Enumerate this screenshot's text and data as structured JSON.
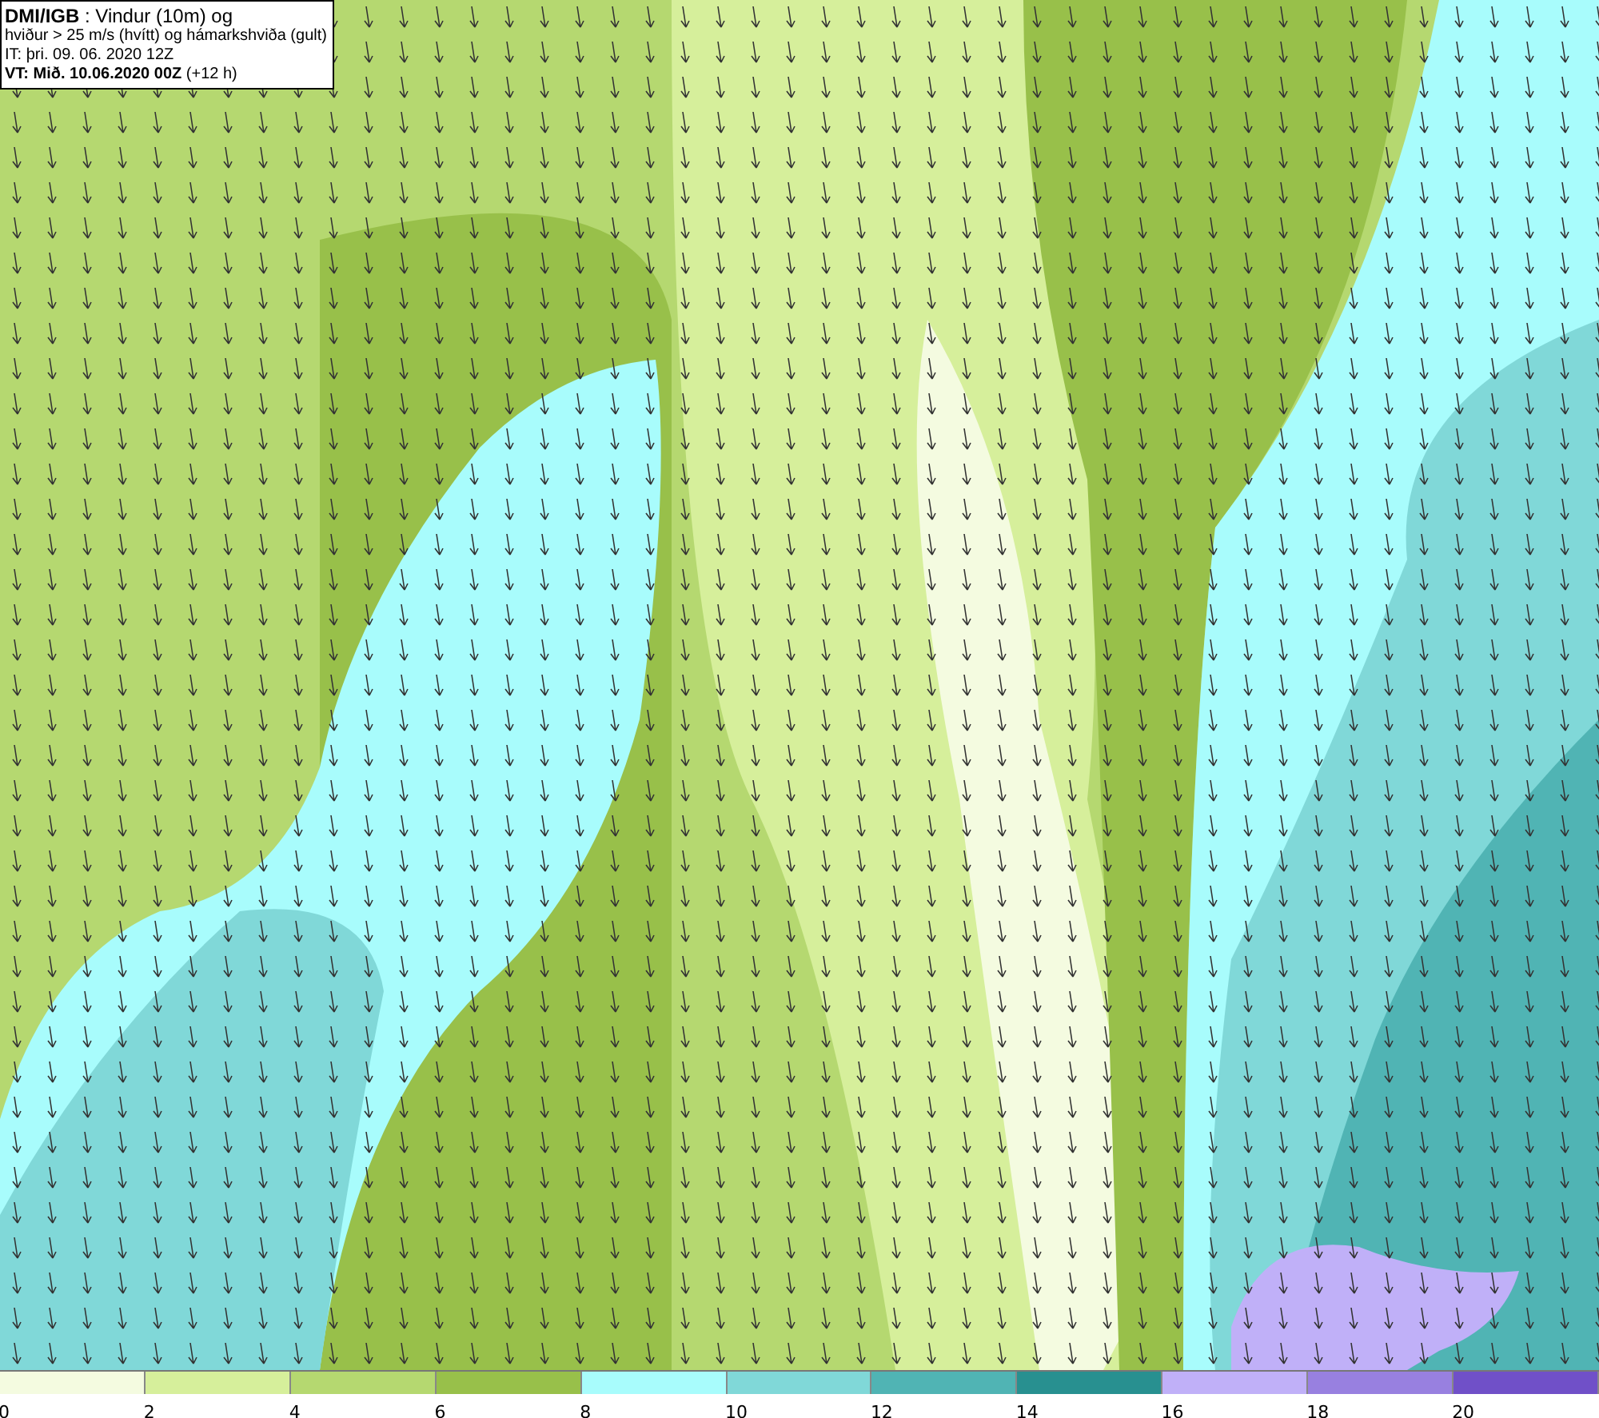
{
  "title_box": {
    "lines": [
      "**DMI/IGB** : Vindur (10m) og",
      "hviður > 25 m/s (hvítt) og hámarkshviða (gult)",
      "IT: þri. 09. 06. 2020 12Z",
      "**VT: Mið. 10.06.2020 00Z** (+12 h)"
    ]
  },
  "legend": [
    {
      "label": "0",
      "color": "#f4fbe0"
    },
    {
      "label": "2",
      "color": "#d6ef9b"
    },
    {
      "label": "4",
      "color": "#b5d870"
    },
    {
      "label": "6",
      "color": "#98c04a"
    },
    {
      "label": "8",
      "color": "#a8fcfc"
    },
    {
      "label": "10",
      "color": "#80d8d8"
    },
    {
      "label": "12",
      "color": "#50b4b4"
    },
    {
      "label": "14",
      "color": "#289090"
    },
    {
      "label": "16",
      "color": "#c0b0f8"
    },
    {
      "label": "18",
      "color": "#9880e0"
    },
    {
      "label": "20",
      "color": "#7050c8"
    }
  ]
}
